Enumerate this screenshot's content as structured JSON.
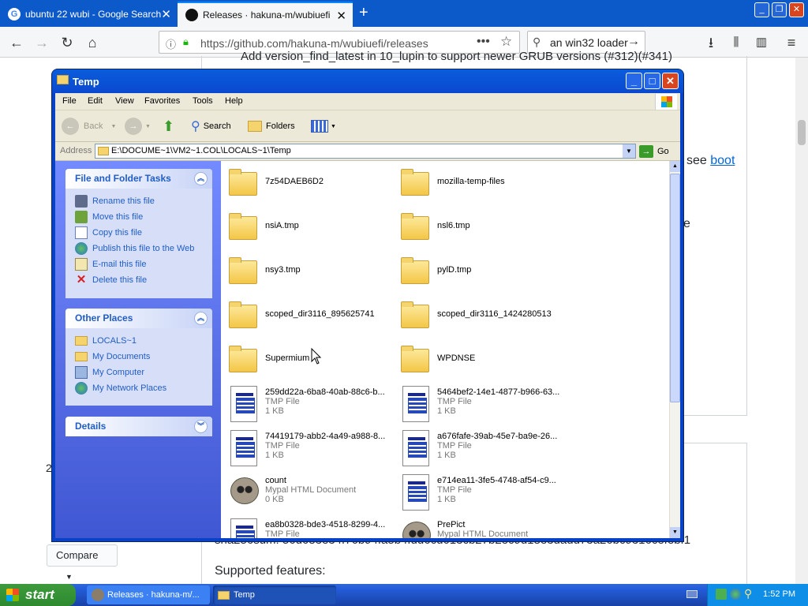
{
  "firefox": {
    "tabs": [
      {
        "title": "ubuntu 22 wubi - Google Search",
        "active": false
      },
      {
        "title": "Releases · hakuna-m/wubiuefi",
        "active": true
      }
    ],
    "url": "https://github.com/hakuna-m/wubiuefi/releases",
    "search_text": "an win32 loader"
  },
  "github": {
    "top_line": "Add version_find_latest in 10_lupin to support newer GRUB versions (#312)(#341)",
    "boot_prefix": "see ",
    "boot_link": "boot",
    "fragment_e": "e",
    "sha_line": "sha256sum: 56d683e34f76b94fa5b4fdd6cd613cb27b2ec9d18e3dadd73a26bc9316cefebf1",
    "supported": "Supported features:",
    "compare": "Compare",
    "side_number": "2"
  },
  "explorer": {
    "title": "Temp",
    "menu": [
      "File",
      "Edit",
      "View",
      "Favorites",
      "Tools",
      "Help"
    ],
    "toolbar": {
      "back": "Back",
      "search": "Search",
      "folders": "Folders"
    },
    "address_label": "Address",
    "address": "E:\\DOCUME~1\\VM2~1.COL\\LOCALS~1\\Temp",
    "go": "Go",
    "tasks": {
      "title": "File and Folder Tasks",
      "items": [
        "Rename this file",
        "Move this file",
        "Copy this file",
        "Publish this file to the Web",
        "E-mail this file",
        "Delete this file"
      ]
    },
    "other_places": {
      "title": "Other Places",
      "items": [
        "LOCALS~1",
        "My Documents",
        "My Computer",
        "My Network Places"
      ]
    },
    "details": {
      "title": "Details"
    },
    "files": [
      {
        "name": "7z54DAEB6D2",
        "type": "folder"
      },
      {
        "name": "mozilla-temp-files",
        "type": "folder"
      },
      {
        "name": "nsiA.tmp",
        "type": "folder"
      },
      {
        "name": "nsl6.tmp",
        "type": "folder"
      },
      {
        "name": "nsy3.tmp",
        "type": "folder"
      },
      {
        "name": "pylD.tmp",
        "type": "folder"
      },
      {
        "name": "scoped_dir3116_895625741",
        "type": "folder"
      },
      {
        "name": "scoped_dir3116_1424280513",
        "type": "folder"
      },
      {
        "name": "Supermium",
        "type": "folder"
      },
      {
        "name": "WPDNSE",
        "type": "folder"
      },
      {
        "name": "259dd22a-6ba8-40ab-88c6-b...",
        "type": "tmp",
        "kind": "TMP File",
        "size": "1 KB"
      },
      {
        "name": "5464bef2-14e1-4877-b966-63...",
        "type": "tmp",
        "kind": "TMP File",
        "size": "1 KB"
      },
      {
        "name": "74419179-abb2-4a49-a988-8...",
        "type": "tmp",
        "kind": "TMP File",
        "size": "1 KB"
      },
      {
        "name": "a676fafe-39ab-45e7-ba9e-26...",
        "type": "tmp",
        "kind": "TMP File",
        "size": "1 KB"
      },
      {
        "name": "count",
        "type": "html",
        "kind": "Mypal HTML Document",
        "size": "0 KB"
      },
      {
        "name": "e714ea11-3fe5-4748-af54-c9...",
        "type": "tmp",
        "kind": "TMP File",
        "size": "1 KB"
      },
      {
        "name": "ea8b0328-bde3-4518-8299-4...",
        "type": "tmp",
        "kind": "TMP File",
        "size": ""
      },
      {
        "name": "PrePict",
        "type": "html",
        "kind": "Mypal HTML Document",
        "size": ""
      }
    ]
  },
  "taskbar": {
    "start": "start",
    "tasks": [
      "Releases · hakuna-m/...",
      "Temp"
    ],
    "clock": "1:52 PM"
  },
  "colors": {
    "xp_blue": "#0842c6",
    "link": "#215dc6",
    "firefox_tabbar": "#0c59c9",
    "github_link": "#0366d6"
  }
}
